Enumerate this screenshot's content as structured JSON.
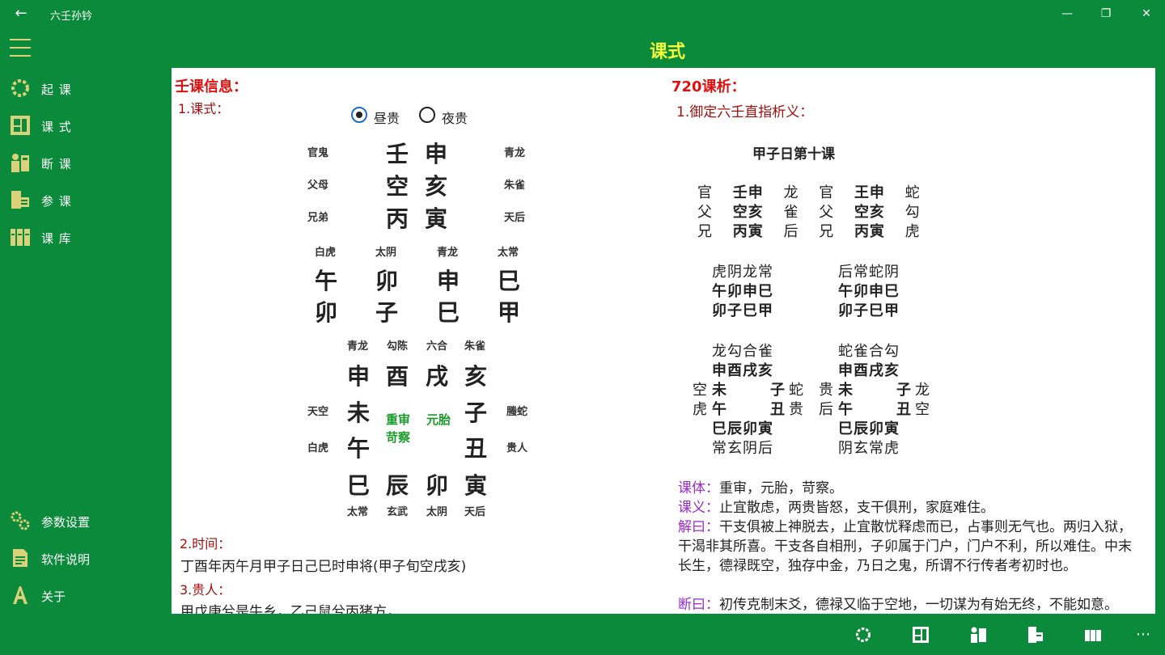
{
  "window": {
    "app_title": "六壬孙钤",
    "back_glyph": "←",
    "minimize_glyph": "—",
    "restore_glyph": "❐",
    "close_glyph": "✕"
  },
  "header": {
    "title": "课式"
  },
  "sidebar": {
    "items": [
      {
        "label": "起 课",
        "icon": "ring-icon"
      },
      {
        "label": "课 式",
        "icon": "layout-icon"
      },
      {
        "label": "断 课",
        "icon": "person-icon"
      },
      {
        "label": "参 课",
        "icon": "reference-icon"
      },
      {
        "label": "课 库",
        "icon": "library-icon"
      }
    ],
    "bottom_items": [
      {
        "label": "参数设置",
        "icon": "gears-icon"
      },
      {
        "label": "软件说明",
        "icon": "document-icon"
      },
      {
        "label": "关于",
        "icon": "letter-a-icon"
      }
    ]
  },
  "left": {
    "heading": "壬课信息：",
    "section1": "1.课式：",
    "radio_day": "昼贵",
    "radio_night": "夜贵",
    "sanchuan": [
      {
        "relation": "官鬼",
        "stem": "壬",
        "branch": "申",
        "god": "青龙"
      },
      {
        "relation": "父母",
        "stem": "空",
        "branch": "亥",
        "god": "朱雀"
      },
      {
        "relation": "兄弟",
        "stem": "丙",
        "branch": "寅",
        "god": "天后"
      }
    ],
    "siké": {
      "gods": [
        "白虎",
        "太阴",
        "青龙",
        "太常"
      ],
      "top": [
        "午",
        "卯",
        "申",
        "巳"
      ],
      "bottom": [
        "卯",
        "子",
        "巳",
        "甲"
      ]
    },
    "board": {
      "top_gods": [
        "青龙",
        "勾陈",
        "六合",
        "朱雀"
      ],
      "top": [
        "申",
        "酉",
        "戌",
        "亥"
      ],
      "left_gods": [
        "天空",
        "白虎"
      ],
      "left": [
        "未",
        "午"
      ],
      "right": [
        "子",
        "丑"
      ],
      "right_gods": [
        "螣蛇",
        "贵人"
      ],
      "bottom": [
        "巳",
        "辰",
        "卯",
        "寅"
      ],
      "bottom_gods": [
        "太常",
        "玄武",
        "太阴",
        "天后"
      ],
      "center1": "重审",
      "center1b": "苛察",
      "center2": "元胎"
    },
    "section2": "2.时间：",
    "time_text": "丁酉年丙午月甲子日己巳时申将(甲子旬空戌亥)",
    "section3": "3.贵人：",
    "noble_text": "甲戊庚兮是牛乡，乙己鼠兮丙猪方，"
  },
  "right": {
    "heading": "720课析：",
    "section1": "1.御定六壬直指析义：",
    "lesson_title": "甲子日第十课",
    "chuan_rows": [
      {
        "a": "官",
        "b": "壬申",
        "c": "龙",
        "d": "官",
        "e": "王申",
        "f": "蛇"
      },
      {
        "a": "父",
        "b": "空亥",
        "c": "雀",
        "d": "父",
        "e": "空亥",
        "f": "勾"
      },
      {
        "a": "兄",
        "b": "丙寅",
        "c": "后",
        "d": "兄",
        "e": "丙寅",
        "f": "虎"
      }
    ],
    "ke_left": [
      "虎阴龙常",
      "午卯申巳",
      "卯子巳甲"
    ],
    "ke_right": [
      "后常蛇阴",
      "午卯申巳",
      "卯子巳甲"
    ],
    "pan_left": {
      "top_gods": "龙勾合雀",
      "top": "申酉戌亥",
      "row1_pre": "空",
      "row1_l": "未",
      "row1_r": "子",
      "row1_post": "蛇",
      "row2_pre": "虎",
      "row2_l": "午",
      "row2_r": "丑",
      "row2_post": "贵",
      "bottom": "巳辰卯寅",
      "bottom_gods": "常玄阴后"
    },
    "pan_right": {
      "top_gods": "蛇雀合勾",
      "top": "申酉戌亥",
      "row1_pre": "贵",
      "row1_l": "未",
      "row1_r": "子",
      "row1_post": "龙",
      "row2_pre": "后",
      "row2_l": "午",
      "row2_r": "丑",
      "row2_post": "空",
      "bottom": "巳辰卯寅",
      "bottom_gods": "阴玄常虎"
    },
    "keti_label": "课体：",
    "keti_text": "重审，元胎，苛察。",
    "keyi_label": "课义：",
    "keyi_text": "止宜散虑，两贵皆怒，支干俱刑，家庭难住。",
    "jie_label": "解曰：",
    "jie_text": "干支俱被上神脱去，止宜散忧释虑而已，占事则无气也。两归入狱，干渴非其所喜。干支各自相刑，子卯属于门户，门户不利，所以难住。中末长生，德禄既空，独存中金，乃日之鬼，所谓不行传者考初时也。",
    "duan_label": "断曰：",
    "duan_text": "初传克制末爻，德禄又临于空地，一切谋为有始无终，不能如意。"
  },
  "bottombar": {
    "more_glyph": "⋯",
    "buttons": [
      "ring-icon",
      "layout-icon",
      "person-icon",
      "reference-icon",
      "library-icon"
    ]
  },
  "colors": {
    "brand_green": "#0a8a3a",
    "title_yellow": "#f5ff3a",
    "heading_red": "#e01010",
    "label_purple": "#9a2ad0",
    "accent_green": "#1a9a2a"
  }
}
